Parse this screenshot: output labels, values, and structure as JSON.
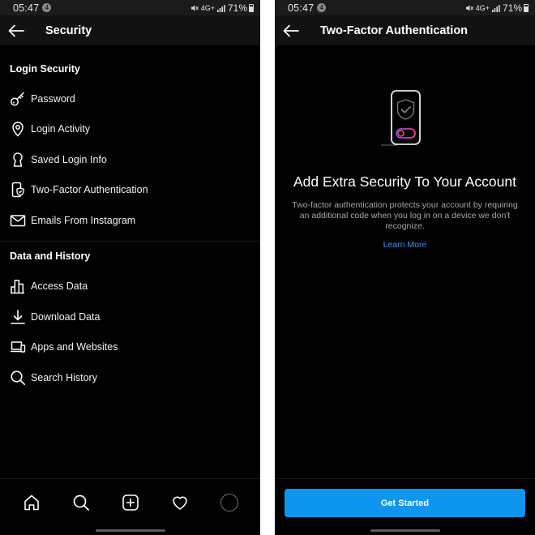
{
  "status_bar": {
    "time": "05:47",
    "notification_count": "4",
    "signal": "4G+",
    "battery": "71%"
  },
  "left": {
    "header": {
      "title": "Security"
    },
    "sections": [
      {
        "title": "Login Security",
        "items": [
          {
            "label": "Password",
            "icon": "key-icon"
          },
          {
            "label": "Login Activity",
            "icon": "location-pin-icon"
          },
          {
            "label": "Saved Login Info",
            "icon": "keyhole-icon"
          },
          {
            "label": "Two-Factor Authentication",
            "icon": "phone-shield-icon"
          },
          {
            "label": "Emails From Instagram",
            "icon": "mail-icon"
          }
        ]
      },
      {
        "title": "Data and History",
        "items": [
          {
            "label": "Access Data",
            "icon": "bar-chart-icon"
          },
          {
            "label": "Download Data",
            "icon": "download-icon"
          },
          {
            "label": "Apps and Websites",
            "icon": "laptop-icon"
          },
          {
            "label": "Search History",
            "icon": "search-icon"
          }
        ]
      }
    ],
    "bottom_nav": [
      "home-icon",
      "search-icon",
      "add-post-icon",
      "heart-icon",
      "profile-avatar"
    ]
  },
  "right": {
    "header": {
      "title": "Two-Factor Authentication"
    },
    "headline": "Add Extra Security To Your Account",
    "description": "Two-factor authentication protects your account by requiring an additional code when you log in on a device we don't recognize.",
    "learn_more": "Learn More",
    "cta": "Get Started"
  },
  "colors": {
    "background": "#000000",
    "header": "#121212",
    "primary": "#0d95f0",
    "link": "#3f8fe8",
    "muted_text": "#a8a8a8"
  }
}
